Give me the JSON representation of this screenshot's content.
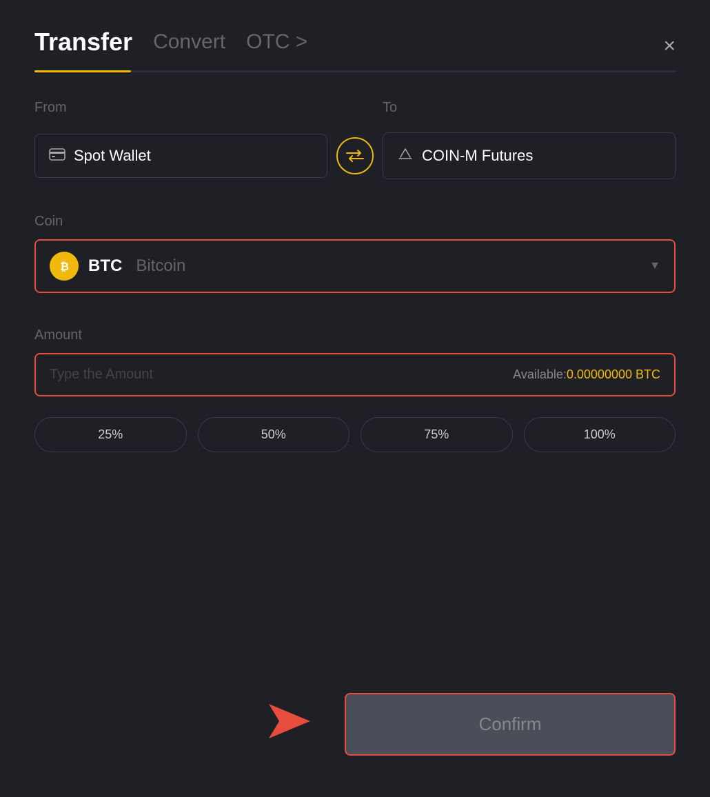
{
  "modal": {
    "title": "Transfer",
    "tabs": [
      {
        "label": "Transfer",
        "active": true
      },
      {
        "label": "Convert",
        "active": false
      },
      {
        "label": "OTC >",
        "active": false
      }
    ],
    "close_label": "×",
    "from_label": "From",
    "to_label": "To",
    "from_wallet": "Spot Wallet",
    "to_wallet": "COIN-M Futures",
    "coin_label": "Coin",
    "coin_symbol": "BTC",
    "coin_name": "Bitcoin",
    "amount_label": "Amount",
    "amount_placeholder": "Type the Amount",
    "available_label": "Available:",
    "available_value": "0.00000000 BTC",
    "percent_buttons": [
      "25%",
      "50%",
      "75%",
      "100%"
    ],
    "confirm_label": "Confirm",
    "swap_icon": "⇄"
  }
}
